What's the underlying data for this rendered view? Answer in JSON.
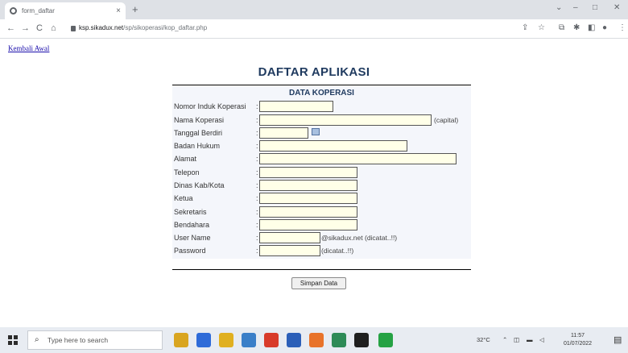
{
  "browser": {
    "tab_title": "form_daftar",
    "tab_close": "×",
    "new_tab": "+",
    "url_host": "ksp.sikadux.net",
    "url_path": "/sp/sikoperasi/kop_daftar.php",
    "nav": {
      "back": "←",
      "forward": "→",
      "reload": "C",
      "home": "⌂"
    },
    "window": {
      "minimize": "–",
      "maximize": "□",
      "close": "✕",
      "chevron": "⌄"
    },
    "toolbar_icons": {
      "share": "⇪",
      "star": "☆",
      "ext": "⧉",
      "pin": "✱",
      "panel": "◧",
      "avatar": "●",
      "menu": "⋮"
    }
  },
  "page": {
    "back_link": "Kembali Awal",
    "title": "DAFTAR APLIKASI",
    "section_title": "DATA KOPERASI",
    "fields": [
      {
        "label": "Nomor Induk Koperasi",
        "value": "",
        "hint": ""
      },
      {
        "label": "Nama Koperasi",
        "value": "",
        "hint": "(capital)"
      },
      {
        "label": "Tanggal Berdiri",
        "value": "",
        "hint": ""
      },
      {
        "label": "Badan Hukum",
        "value": "",
        "hint": ""
      },
      {
        "label": "Alamat",
        "value": "",
        "hint": ""
      },
      {
        "label": "Telepon",
        "value": "",
        "hint": ""
      },
      {
        "label": "Dinas Kab/Kota",
        "value": "",
        "hint": ""
      },
      {
        "label": "Ketua",
        "value": "",
        "hint": ""
      },
      {
        "label": "Sekretaris",
        "value": "",
        "hint": ""
      },
      {
        "label": "Bendahara",
        "value": "",
        "hint": ""
      },
      {
        "label": "User Name",
        "value": "",
        "hint": "@sikadux.net (dicatat..!!)"
      },
      {
        "label": "Password",
        "value": "",
        "hint": "(dicatat..!!)"
      }
    ],
    "colon": ":",
    "submit_label": "Simpan Data"
  },
  "taskbar": {
    "search_placeholder": "Type here to search",
    "weather": "32°C",
    "time": "11:57",
    "date": "01/07/2022",
    "app_colors": [
      "#d9a520",
      "#2e6bd8",
      "#e0b020",
      "#3a7fc8",
      "#d83b2a",
      "#2b5fb8",
      "#e8732a",
      "#2e8b57",
      "#1f1f1f",
      "#25a244"
    ]
  }
}
